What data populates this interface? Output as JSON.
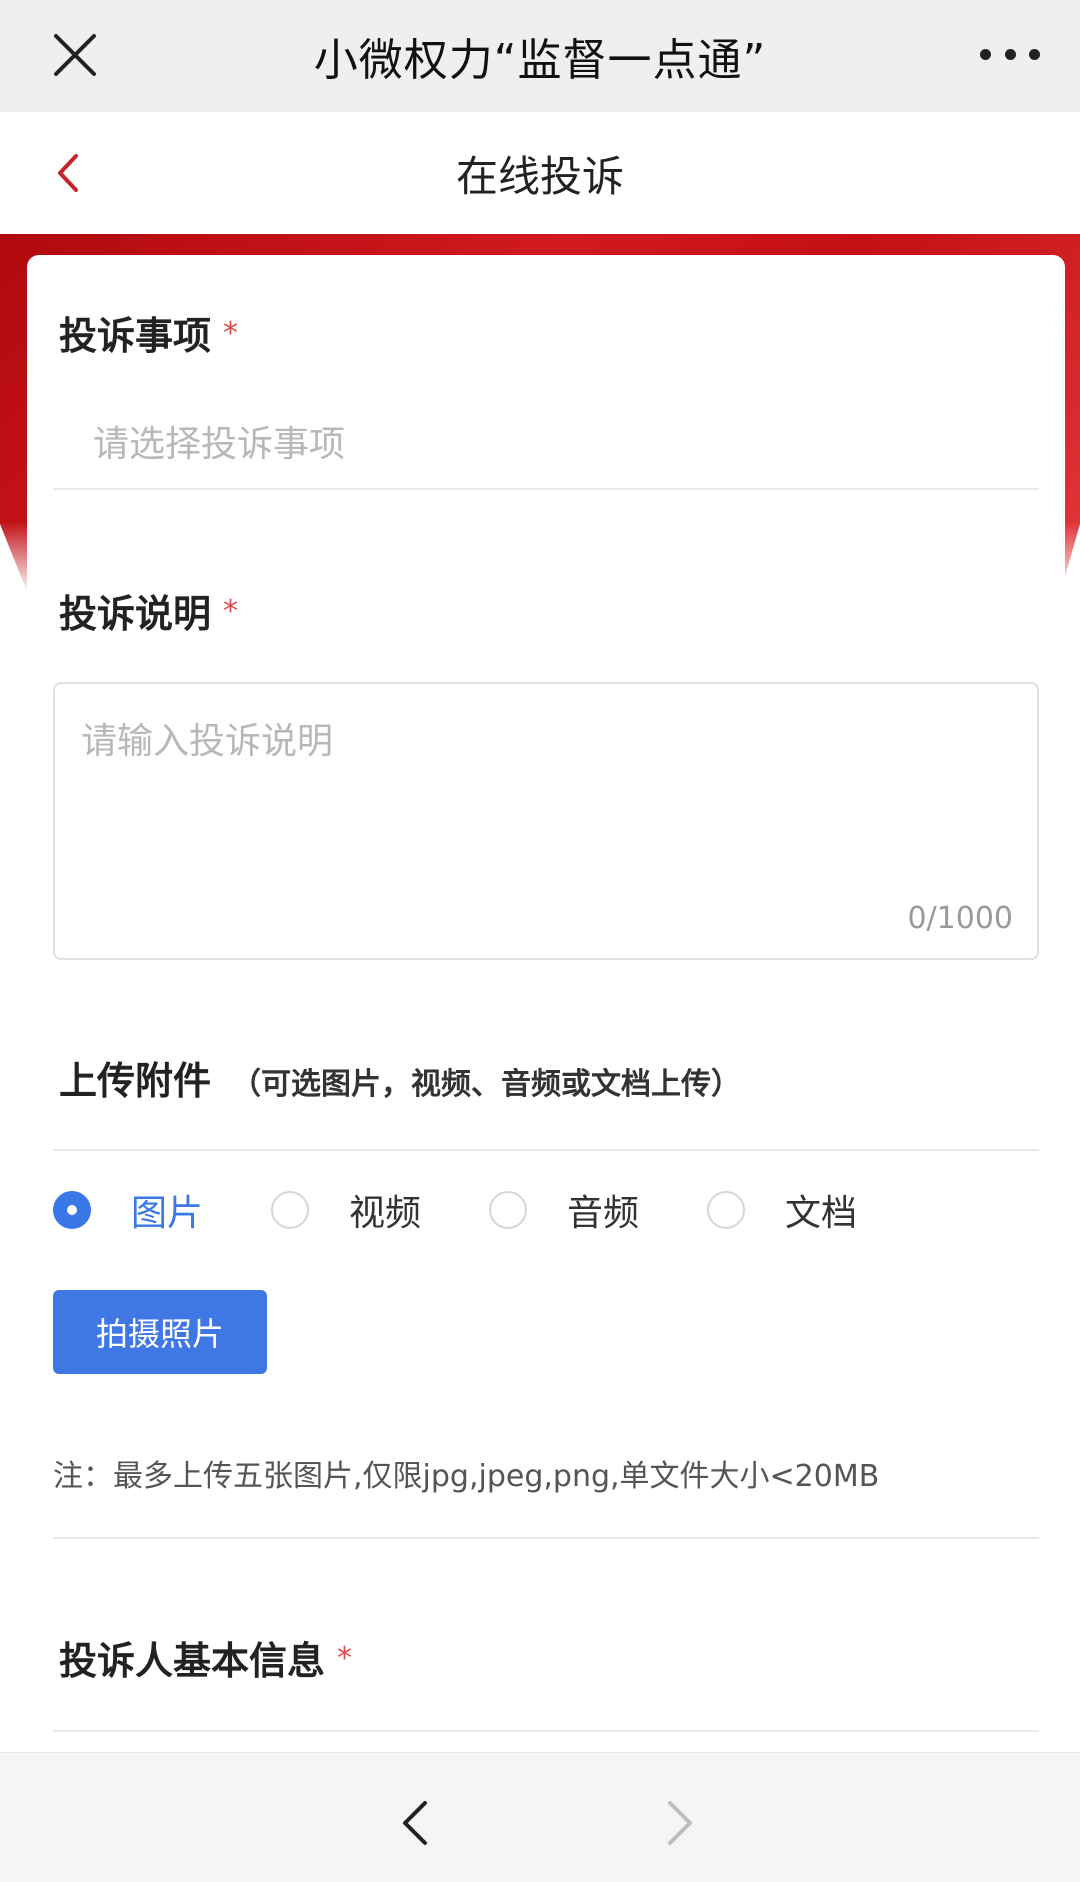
{
  "topbar": {
    "title": "小微权力“监督一点通”",
    "close_icon": "close-icon",
    "more_icon": "more-icon"
  },
  "header": {
    "title": "在线投诉",
    "back_icon": "chevron-left-icon"
  },
  "form": {
    "complaint_item": {
      "label": "投诉事项",
      "required_mark": "*",
      "placeholder": "请选择投诉事项"
    },
    "complaint_desc": {
      "label": "投诉说明",
      "required_mark": "*",
      "placeholder": "请输入投诉说明",
      "counter": "0/1000"
    },
    "upload": {
      "title": "上传附件",
      "note": "（可选图片，视频、音频或文档上传）",
      "options": [
        {
          "label": "图片",
          "checked": true
        },
        {
          "label": "视频",
          "checked": false
        },
        {
          "label": "音频",
          "checked": false
        },
        {
          "label": "文档",
          "checked": false
        }
      ],
      "button_label": "拍摄照片",
      "hint": "注：最多上传五张图片,仅限jpg,jpeg,png,单文件大小<20MB"
    },
    "complainant": {
      "label": "投诉人基本信息",
      "required_mark": "*"
    }
  },
  "colors": {
    "accent": "#3f78e5",
    "required": "#e04a4a",
    "banner": "#c40f14"
  },
  "bottom_nav": {
    "back_icon": "chevron-left-icon",
    "forward_icon": "chevron-right-icon"
  }
}
